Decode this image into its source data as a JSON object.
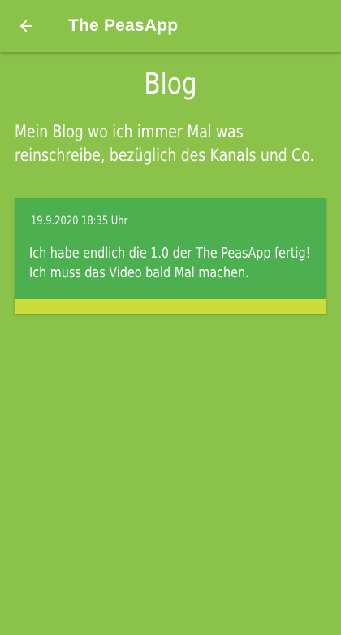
{
  "app_bar": {
    "title": "The PeasApp",
    "back_icon": "arrow-back-icon"
  },
  "page": {
    "heading": "Blog",
    "intro": "Mein Blog wo ich immer Mal was reinschreibe, bezüglich des Kanals und Co."
  },
  "posts": [
    {
      "date": "19.9.2020 18:35 Uhr",
      "text": "Ich habe endlich die 1.0 der The PeasApp fertig! Ich muss das Video bald Mal machen."
    }
  ],
  "colors": {
    "background": "#8bc34a",
    "card": "#4caf50",
    "card_accent": "#cddc39",
    "text": "#ffffff"
  }
}
